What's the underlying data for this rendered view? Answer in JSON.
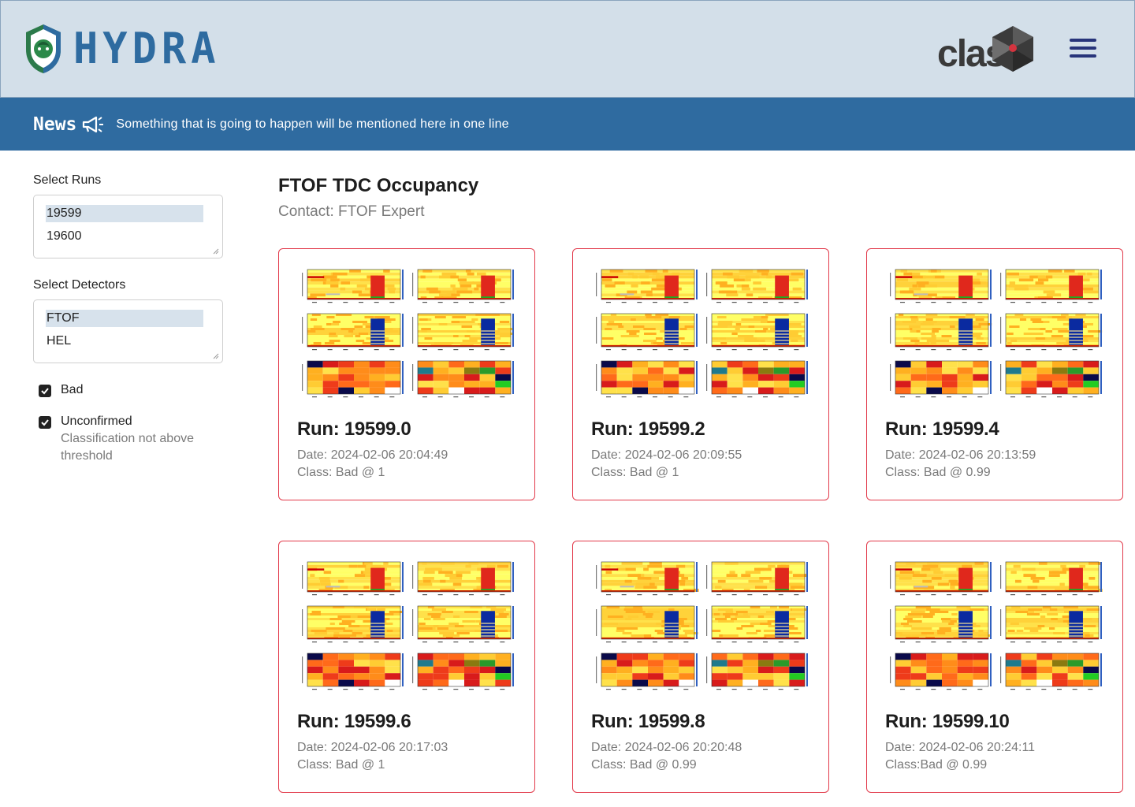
{
  "header": {
    "app_name": "HYDRA",
    "partner_logo": "clas",
    "menu_icon": "hamburger-menu-icon",
    "colors": {
      "header_bg": "#d3dfe9",
      "brand_blue": "#2e6ba0",
      "menu_navy": "#27347a"
    }
  },
  "news": {
    "title": "News",
    "icon": "megaphone-icon",
    "text": "Something that is going to happen will be mentioned here in one line",
    "bg": "#2f6ba0"
  },
  "sidebar": {
    "runs": {
      "label": "Select Runs",
      "options": [
        "19599",
        "19600"
      ],
      "selected": "19599"
    },
    "detectors": {
      "label": "Select Detectors",
      "options": [
        "FTOF",
        "HEL"
      ],
      "selected": "FTOF"
    },
    "filters": [
      {
        "label": "Bad",
        "checked": true,
        "description": ""
      },
      {
        "label": "Unconfirmed",
        "checked": true,
        "description": "Classification not above threshold"
      }
    ]
  },
  "main": {
    "title": "FTOF TDC Occupancy",
    "contact": "Contact: FTOF Expert",
    "card_border_color": "#e23a4b",
    "cards": [
      {
        "run": "Run: 19599.0",
        "date": "Date: 2024-02-06 20:04:49",
        "class": "Class: Bad @ 1"
      },
      {
        "run": "Run: 19599.2",
        "date": "Date: 2024-02-06 20:09:55",
        "class": "Class: Bad @ 1"
      },
      {
        "run": "Run: 19599.4",
        "date": "Date: 2024-02-06 20:13:59",
        "class": "Class: Bad @ 0.99"
      },
      {
        "run": "Run: 19599.6",
        "date": "Date: 2024-02-06 20:17:03",
        "class": "Class: Bad @ 1"
      },
      {
        "run": "Run: 19599.8",
        "date": "Date: 2024-02-06 20:20:48",
        "class": "Class: Bad @ 0.99"
      },
      {
        "run": "Run: 19599.10",
        "date": "Date: 2024-02-06 20:24:11",
        "class": "Class:Bad @ 0.99"
      }
    ]
  }
}
